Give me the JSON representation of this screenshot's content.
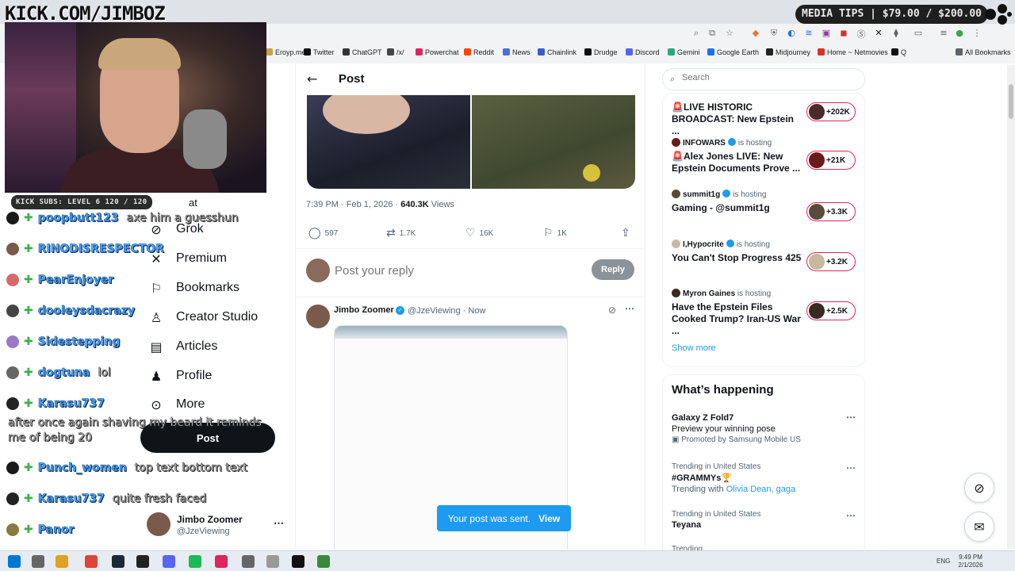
{
  "overlay": {
    "kick_url": "KICK.COM/JIMBOZ",
    "media_tips": "MEDIA TIPS | $79.00 / $200.00",
    "kick_subs": "KICK SUBS: LEVEL 6 120 / 120"
  },
  "bookmarks": [
    {
      "label": "Eroyp.me",
      "color": "#c8a04a"
    },
    {
      "label": "Twitter",
      "color": "#111111"
    },
    {
      "label": "ChatGPT",
      "color": "#333333"
    },
    {
      "label": "/x/",
      "color": "#444444"
    },
    {
      "label": "Powerchat",
      "color": "#e0245e"
    },
    {
      "label": "Reddit",
      "color": "#ff4500"
    },
    {
      "label": "News",
      "color": "#4a6ee0"
    },
    {
      "label": "Chainlink",
      "color": "#375bd2"
    },
    {
      "label": "Drudge",
      "color": "#111111"
    },
    {
      "label": "Discord",
      "color": "#5865f2"
    },
    {
      "label": "Gemini",
      "color": "#2aa87a"
    },
    {
      "label": "Google Earth",
      "color": "#1a73e8"
    },
    {
      "label": "Midjourney",
      "color": "#222222"
    },
    {
      "label": "Home ~ Netmovies",
      "color": "#d93025"
    },
    {
      "label": "Q",
      "color": "#111111"
    },
    {
      "label": "All Bookmarks",
      "color": "#5f6368"
    }
  ],
  "nav": {
    "items": [
      {
        "label": "Grok",
        "icon": "grok-icon"
      },
      {
        "label": "Premium",
        "icon": "x-icon"
      },
      {
        "label": "Bookmarks",
        "icon": "bookmark-icon"
      },
      {
        "label": "Creator Studio",
        "icon": "creator-icon"
      },
      {
        "label": "Articles",
        "icon": "articles-icon"
      },
      {
        "label": "Profile",
        "icon": "profile-icon"
      },
      {
        "label": "More",
        "icon": "more-icon"
      }
    ],
    "partial_label": "at",
    "post_button": "Post",
    "account_name": "Jimbo Zoomer",
    "account_handle": "@JzeViewing"
  },
  "chat": {
    "messages": [
      {
        "user": "poopbutt123",
        "msg": "axe him a guesshun",
        "badge": "K",
        "avatar": "#1a1a1a"
      },
      {
        "user": "RINODISRESPECTOR",
        "msg": "",
        "badge": "",
        "avatar": "#7a5a4a"
      },
      {
        "user": "PearEnjoyer",
        "msg": "",
        "badge": "",
        "avatar": "#d66a6a"
      },
      {
        "user": "dooleysdacrazy",
        "msg": "",
        "badge": "",
        "avatar": "#444444"
      },
      {
        "user": "Sidestepping",
        "msg": "",
        "badge": "",
        "avatar": "#9a7ac8"
      },
      {
        "user": "dogtuna",
        "msg": "lol",
        "badge": "",
        "avatar": "#666666"
      },
      {
        "user": "Karasu737",
        "msg": "",
        "badge": "",
        "avatar": "#222222"
      },
      {
        "user": "Punch_women",
        "msg": "top text bottom text",
        "badge": "K",
        "avatar": "#1a1a1a"
      },
      {
        "user": "Karasu737",
        "msg": "quite fresh faced",
        "badge": "",
        "avatar": "#222222"
      },
      {
        "user": "Panor",
        "msg": "",
        "badge": "",
        "avatar": "#8a7a40"
      }
    ],
    "long_message": "after once again shaving my beard it reminds me of being 20"
  },
  "post": {
    "back_label": "←",
    "title": "Post",
    "time": "7:39 PM · Feb 1, 2026 · ",
    "views_count": "640.3K",
    "views_label": " Views",
    "replies": "597",
    "reposts": "1.7K",
    "likes": "16K",
    "bookmarks": "1K",
    "reply_placeholder": "Post your reply",
    "reply_button": "Reply"
  },
  "tweet": {
    "name": "Jimbo Zoomer",
    "handle": "@JzeViewing · Now"
  },
  "toast": {
    "text": "Your post was sent.",
    "view": "View"
  },
  "search": {
    "placeholder": "Search"
  },
  "live": [
    {
      "host": "",
      "verified": false,
      "title": "🚨LIVE HISTORIC BROADCAST: New Epstein ...",
      "count": "+202K",
      "avatar": "#4a2a2a"
    },
    {
      "host": "INFOWARS",
      "verified": true,
      "hosting": "is hosting",
      "title": "🚨Alex Jones LIVE: New Epstein Documents Prove ...",
      "count": "+21K",
      "avatar": "#6a1a1a"
    },
    {
      "host": "summit1g",
      "verified": true,
      "hosting": "is hosting",
      "title": "Gaming - @summit1g",
      "count": "+3.3K",
      "avatar": "#5a4a3a"
    },
    {
      "host": "I,Hypocrite",
      "verified": true,
      "hosting": "is hosting",
      "title": "You Can't Stop Progress 425",
      "count": "+3.2K",
      "avatar": "#c8b8a0"
    },
    {
      "host": "Myron Gaines",
      "verified": false,
      "hosting": "is hosting",
      "title": "Have the Epstein Files Cooked Trump? Iran-US War ...",
      "count": "+2.5K",
      "avatar": "#3a2a20"
    }
  ],
  "show_more": "Show more",
  "happening": {
    "title": "What’s happening",
    "trends": [
      {
        "context": "",
        "name": "Galaxy Z Fold7",
        "sub": "Preview your winning pose",
        "promo": "Promoted by Samsung Mobile US"
      },
      {
        "context": "Trending in United States",
        "name": "#GRAMMYs🏆",
        "sub_prefix": "Trending with ",
        "sub_links": "Olivia Dean, gaga"
      },
      {
        "context": "Trending in United States",
        "name": "Teyana"
      },
      {
        "context": "Trending"
      }
    ]
  },
  "taskbar": {
    "lang": "ENG",
    "time": "9:49 PM",
    "date": "2/1/2026",
    "icons": [
      "#0078d4",
      "#666",
      "#e0a020",
      "#db4437",
      "#1b2838",
      "#222",
      "#5865f2",
      "#1db954",
      "#e0245e",
      "#666",
      "#999",
      "#111",
      "#3a8a3a"
    ]
  }
}
